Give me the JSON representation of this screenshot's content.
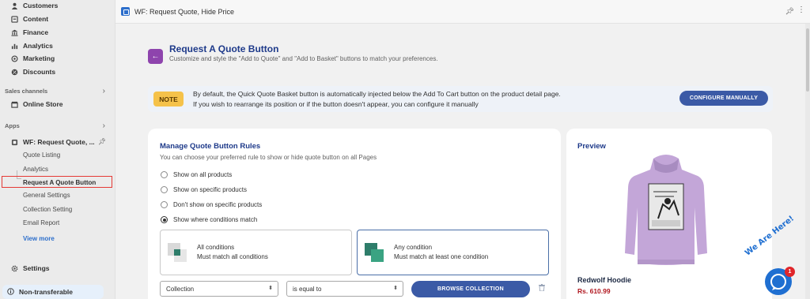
{
  "sidebar": {
    "items": [
      {
        "label": "Customers",
        "icon": "person-icon"
      },
      {
        "label": "Content",
        "icon": "content-icon"
      },
      {
        "label": "Finance",
        "icon": "bank-icon"
      },
      {
        "label": "Analytics",
        "icon": "bar-chart-icon"
      },
      {
        "label": "Marketing",
        "icon": "target-icon"
      },
      {
        "label": "Discounts",
        "icon": "discount-icon"
      }
    ],
    "sales_channels_label": "Sales channels",
    "online_store_label": "Online Store",
    "apps_label": "Apps",
    "app_name": "WF: Request Quote, ...",
    "app_subitems": [
      "Quote Listing",
      "Analytics",
      "Request A Quote Button",
      "General Settings",
      "Collection Setting",
      "Email Report"
    ],
    "view_more": "View more",
    "settings_label": "Settings",
    "non_transferable_label": "Non-transferable"
  },
  "topbar": {
    "title": "WF: Request Quote, Hide Price"
  },
  "header": {
    "title": "Request A Quote Button",
    "subtitle": "Customize and style the \"Add to Quote\" and \"Add to Basket\" buttons to match your preferences."
  },
  "note": {
    "tag": "NOTE",
    "line1": "By default, the Quick Quote Basket button is automatically injected below the Add To Cart button on the product detail page.",
    "line2": "If you wish to rearrange its position or if the button doesn't appear, you can configure it manually",
    "button": "CONFIGURE MANUALLY"
  },
  "rules": {
    "title": "Manage Quote Button Rules",
    "subtitle": "You can choose your preferred rule to show or hide quote button on all Pages",
    "options": [
      "Show on all products",
      "Show on specific products",
      "Don't show on specific products",
      "Show where conditions match"
    ],
    "selected_option": "Show where conditions match",
    "conditions": [
      {
        "title": "All conditions",
        "desc": "Must match all conditions"
      },
      {
        "title": "Any condition",
        "desc": "Must match at least one condition"
      }
    ],
    "selected_condition": "Any condition",
    "field_select": "Collection",
    "operator_select": "is equal to",
    "browse_button": "BROWSE COLLECTION"
  },
  "preview": {
    "title": "Preview",
    "product_name": "Redwolf Hoodie",
    "price": "Rs. 610.99"
  },
  "chat": {
    "label": "We Are Here!",
    "badge": "1"
  },
  "colors": {
    "accent": "#3b5aa6",
    "title": "#1e3a8a",
    "back_button": "#8e44ad",
    "note_tag": "#f5c24a",
    "price": "#b0171f",
    "hoodie": "#c3a6d8"
  }
}
